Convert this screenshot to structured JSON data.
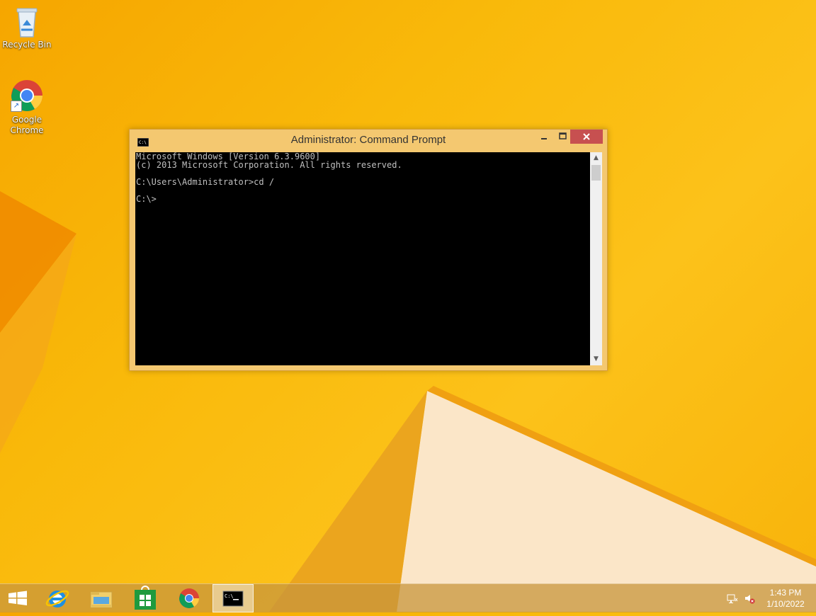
{
  "desktop": {
    "icons": [
      {
        "label": "Recycle Bin",
        "icon": "recycle-bin-icon"
      },
      {
        "label": "Google Chrome",
        "icon": "chrome-icon"
      }
    ]
  },
  "window": {
    "title": "Administrator: Command Prompt",
    "icon": "console-icon",
    "close_color": "#c75050",
    "console_lines": [
      "Microsoft Windows [Version 6.3.9600]",
      "(c) 2013 Microsoft Corporation. All rights reserved.",
      "",
      "C:\\Users\\Administrator>cd /",
      "",
      "C:\\>"
    ]
  },
  "taskbar": {
    "items": [
      {
        "icon": "windows-start-icon"
      },
      {
        "icon": "internet-explorer-icon"
      },
      {
        "icon": "file-explorer-icon"
      },
      {
        "icon": "windows-store-icon"
      },
      {
        "icon": "chrome-icon"
      },
      {
        "icon": "command-prompt-icon",
        "active": true
      }
    ],
    "tray": [
      {
        "icon": "network-icon"
      },
      {
        "icon": "speaker-muted-icon"
      }
    ],
    "clock": {
      "time": "1:43 PM",
      "date": "1/10/2022"
    }
  },
  "colors": {
    "wallpaper_accent": "#fcc21a",
    "console_bg": "#000000",
    "console_text": "#c0c0c0"
  }
}
